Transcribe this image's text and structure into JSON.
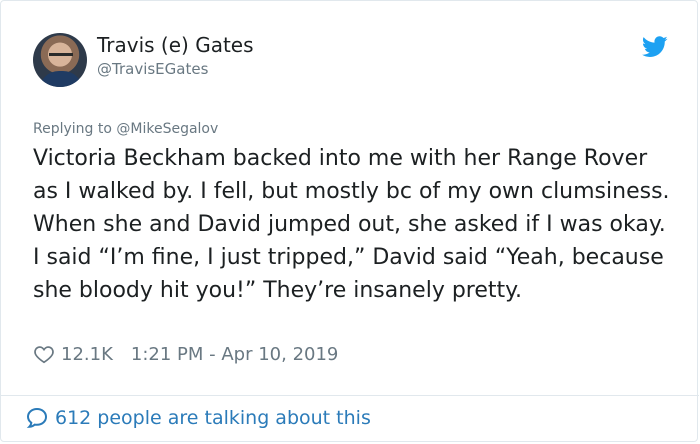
{
  "author": {
    "name": "Travis (e) Gates",
    "handle": "@TravisEGates"
  },
  "reply_context": {
    "prefix": "Replying to ",
    "mention": "@MikeSegalov"
  },
  "tweet": {
    "text": "Victoria Beckham backed into me with her Range Rover as I walked by. I fell, but mostly bc of my own clumsiness. When she and David jumped out, she asked if I was okay. I said “I’m fine, I just tripped,” David said “Yeah, because she bloody hit you!” They’re insanely pretty."
  },
  "meta": {
    "likes": "12.1K",
    "timestamp": "1:21 PM - Apr 10, 2019"
  },
  "footer": {
    "conversation": "612 people are talking about this"
  },
  "icons": {
    "logo": "twitter-bird-icon",
    "like": "heart-outline-icon",
    "conversation": "speech-bubble-icon"
  },
  "colors": {
    "brand": "#1da1f2",
    "link": "#2b7bb9",
    "muted": "#697882",
    "text": "#1c2022"
  }
}
